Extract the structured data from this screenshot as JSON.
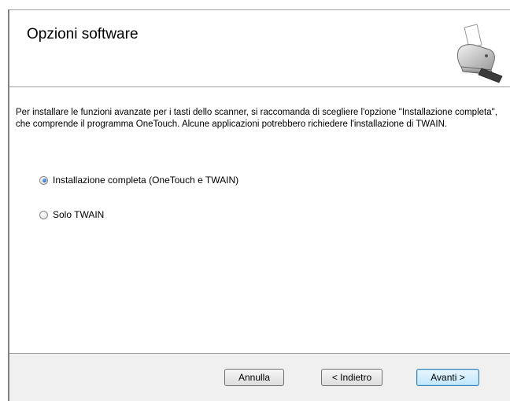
{
  "header": {
    "title": "Opzioni software"
  },
  "content": {
    "description": "Per installare le funzioni avanzate per i tasti dello scanner, si raccomanda di scegliere l'opzione \"Installazione completa\", che comprende il programma OneTouch. Alcune applicazioni potrebbero richiedere l'installazione di TWAIN.",
    "options": [
      {
        "label": "Installazione completa (OneTouch e TWAIN)",
        "selected": true
      },
      {
        "label": "Solo TWAIN",
        "selected": false
      }
    ]
  },
  "footer": {
    "cancel_label": "Annulla",
    "back_label": "< Indietro",
    "next_label": "Avanti >"
  },
  "colors": {
    "footer_background": "#f0f0f0",
    "primary_button_border": "#3c7fb1"
  }
}
